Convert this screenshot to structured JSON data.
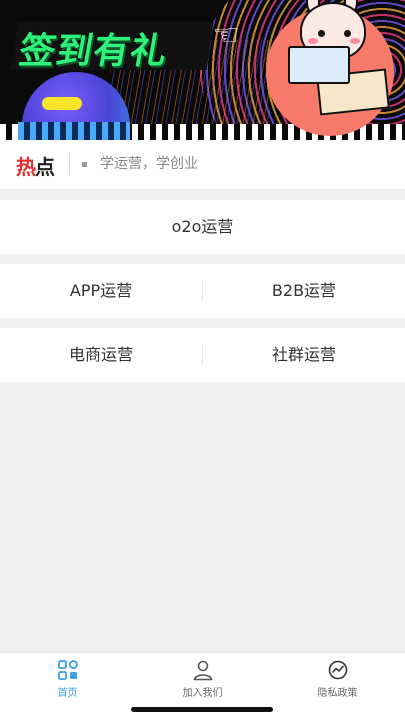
{
  "banner": {
    "title": "签到有礼",
    "hand_icon": "pointing-hand-icon",
    "accent_color": "#2ff27a"
  },
  "hotbar": {
    "logo_re": "热",
    "logo_dian": "点",
    "text": "学运营，学创业"
  },
  "menu": {
    "row1": {
      "center": "o2o运营"
    },
    "row2": {
      "left": "APP运营",
      "right": "B2B运营"
    },
    "row3": {
      "left": "电商运营",
      "right": "社群运营"
    }
  },
  "tabbar": {
    "tabs": [
      {
        "label": "首页",
        "icon": "home-grid-icon",
        "active": true
      },
      {
        "label": "加入我们",
        "icon": "user-icon",
        "active": false
      },
      {
        "label": "隐私政策",
        "icon": "privacy-chart-icon",
        "active": false
      }
    ],
    "active_color": "#3aa0e8"
  }
}
